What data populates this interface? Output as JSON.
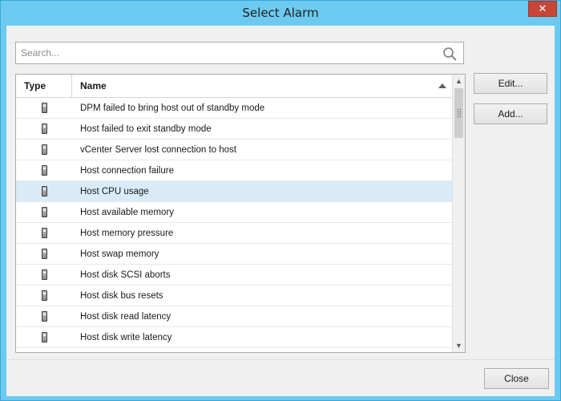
{
  "window": {
    "title": "Select Alarm",
    "close_glyph": "✕"
  },
  "search": {
    "placeholder": "Search...",
    "value": "",
    "icon": "search-icon"
  },
  "table": {
    "columns": {
      "type": "Type",
      "name": "Name"
    },
    "sort": {
      "column": "name",
      "direction": "ascending"
    },
    "selected_index": 4,
    "row_icon": "host-device-icon",
    "rows": [
      {
        "name": "DPM failed to bring host out of standby mode"
      },
      {
        "name": "Host failed to exit standby mode"
      },
      {
        "name": "vCenter Server lost connection to host"
      },
      {
        "name": "Host connection failure"
      },
      {
        "name": "Host CPU usage"
      },
      {
        "name": "Host available memory"
      },
      {
        "name": "Host memory pressure"
      },
      {
        "name": "Host swap memory"
      },
      {
        "name": "Host disk SCSI aborts"
      },
      {
        "name": "Host disk bus resets"
      },
      {
        "name": "Host disk read latency"
      },
      {
        "name": "Host disk write latency"
      }
    ]
  },
  "buttons": {
    "edit": "Edit...",
    "add": "Add...",
    "close": "Close"
  },
  "colors": {
    "title_bar": "#6ccaf0",
    "selected_row": "#d9ebf9",
    "close_button": "#c7463a"
  }
}
